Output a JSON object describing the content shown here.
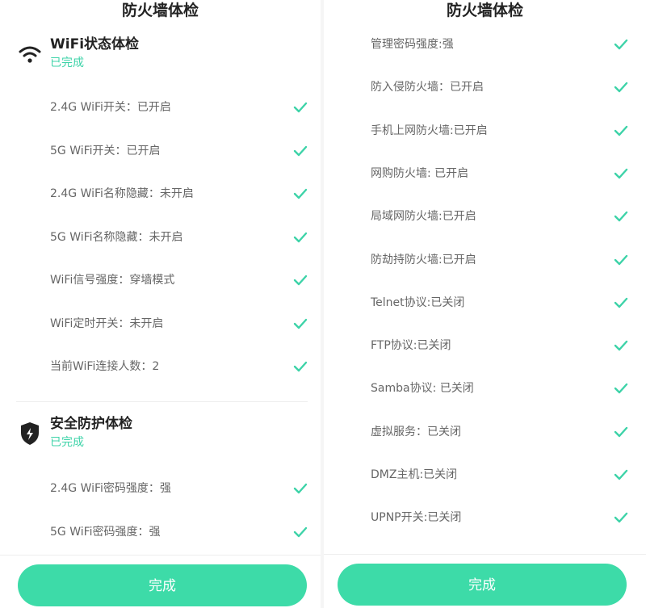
{
  "colors": {
    "accent": "#3ddba8",
    "status": "#3dd3a8",
    "check": "#3dd3a8"
  },
  "left": {
    "title": "防火墙体检",
    "wifi_section": {
      "icon": "wifi-icon",
      "name": "WiFi状态体检",
      "status": "已完成",
      "items": [
        "2.4G WiFi开关：已开启",
        "5G WiFi开关：已开启",
        "2.4G WiFi名称隐藏：未开启",
        "5G WiFi名称隐藏：未开启",
        "WiFi信号强度：穿墙模式",
        "WiFi定时开关：未开启",
        "当前WiFi连接人数：2"
      ]
    },
    "security_section": {
      "icon": "shield-bolt-icon",
      "name": "安全防护体检",
      "status": "已完成",
      "items": [
        "2.4G WiFi密码强度：强",
        "5G WiFi密码强度：强"
      ]
    },
    "done_button": "完成"
  },
  "right": {
    "title": "防火墙体检",
    "items": [
      "管理密码强度:强",
      "防入侵防火墙：已开启",
      "手机上网防火墙:已开启",
      "网购防火墙: 已开启",
      "局域网防火墙:已开启",
      "防劫持防火墙:已开启",
      "Telnet协议:已关闭",
      "FTP协议:已关闭",
      "Samba协议: 已关闭",
      "虚拟服务：已关闭",
      "DMZ主机:已关闭",
      "UPNP开关:已关闭"
    ],
    "done_button": "完成"
  }
}
